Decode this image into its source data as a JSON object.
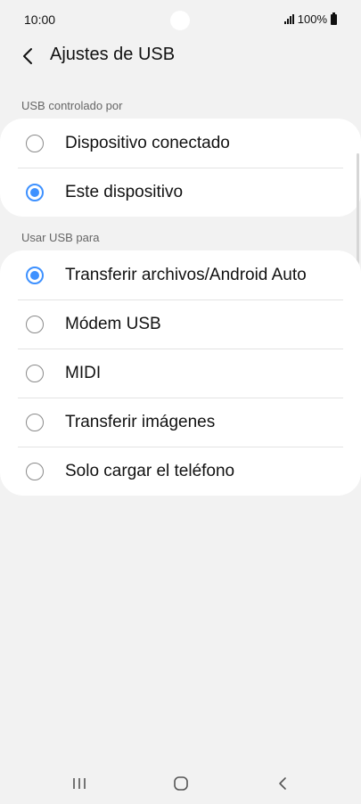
{
  "status_bar": {
    "time": "10:00",
    "battery": "100%",
    "icons": [
      "signal-icon",
      "battery-icon"
    ]
  },
  "app_bar": {
    "back_icon": "back-arrow-icon",
    "title": "Ajustes de USB"
  },
  "sections": [
    {
      "header": "USB controlado por",
      "options": [
        {
          "label": "Dispositivo conectado",
          "selected": false
        },
        {
          "label": "Este dispositivo",
          "selected": true
        }
      ]
    },
    {
      "header": "Usar USB para",
      "options": [
        {
          "label": "Transferir archivos/Android Auto",
          "selected": true
        },
        {
          "label": "Módem USB",
          "selected": false
        },
        {
          "label": "MIDI",
          "selected": false
        },
        {
          "label": "Transferir imágenes",
          "selected": false
        },
        {
          "label": "Solo cargar el teléfono",
          "selected": false
        }
      ]
    }
  ],
  "nav_bar": {
    "icons": [
      "recents-icon",
      "home-icon",
      "back-icon"
    ]
  },
  "colors": {
    "accent": "#3e91ff",
    "background": "#f2f2f2",
    "card": "#ffffff"
  }
}
